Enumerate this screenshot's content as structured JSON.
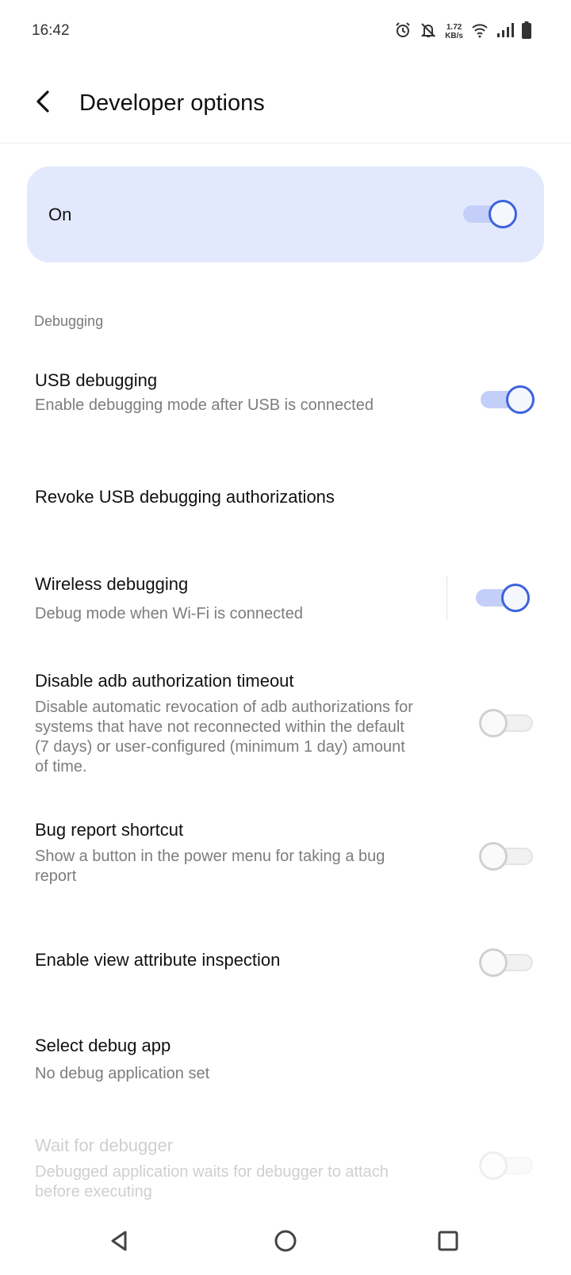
{
  "status_bar": {
    "time": "16:42",
    "net_speed_value": "1.72",
    "net_speed_unit": "KB/s",
    "icons": [
      "alarm-icon",
      "bell-off-icon",
      "wifi-icon",
      "cellular-signal-icon",
      "battery-icon"
    ]
  },
  "header": {
    "title": "Developer options",
    "back_icon": "chevron-left-icon"
  },
  "master_toggle": {
    "label": "On",
    "state": true,
    "accent": "#3d63dd",
    "card_color": "#e3e9fd"
  },
  "section": {
    "title": "Debugging"
  },
  "settings": [
    {
      "title": "USB debugging",
      "subtitle": "Enable debugging mode after USB is connected",
      "toggle": true
    },
    {
      "title": "Revoke USB debugging authorizations"
    },
    {
      "title": "Wireless debugging",
      "subtitle": "Debug mode when Wi-Fi is connected",
      "toggle": true
    },
    {
      "title": "Disable adb authorization timeout",
      "subtitle_lines": [
        "Disable automatic revocation of adb authorizations for",
        "systems that have not reconnected within the default",
        "(7 days) or user-configured (minimum 1 day) amount",
        "of time."
      ],
      "toggle": false
    },
    {
      "title": "Bug report shortcut",
      "subtitle_lines": [
        "Show a button in the power menu for taking a bug",
        "report"
      ],
      "toggle": false
    },
    {
      "title": "Enable view attribute inspection",
      "toggle": false
    },
    {
      "title": "Select debug app",
      "subtitle": "No debug application set"
    },
    {
      "title": "Wait for debugger",
      "subtitle_lines": [
        "Debugged application waits for debugger to attach",
        "before executing"
      ],
      "toggle": false,
      "enabled": false
    }
  ],
  "nav_bar": {
    "icons": [
      "back-triangle-icon",
      "home-circle-icon",
      "recents-square-icon"
    ]
  }
}
